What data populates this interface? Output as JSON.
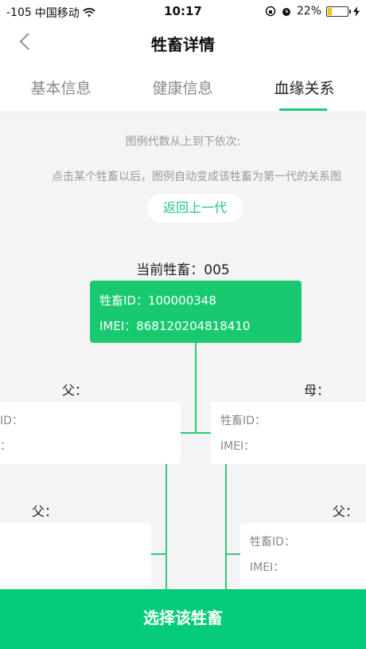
{
  "status_bar": {
    "signal": "-105",
    "carrier": "中国移动",
    "time": "10:17",
    "battery": "22%",
    "battery_level": 0.22
  },
  "nav": {
    "title": "牲畜详情",
    "back_icon": "chevron-left-icon"
  },
  "tabs": [
    {
      "label": "基本信息",
      "active": false
    },
    {
      "label": "健康信息",
      "active": false
    },
    {
      "label": "血缘关系",
      "active": true
    }
  ],
  "hints": {
    "line1": "图例代数从上到下依次:",
    "line2": "点击某个牲畜以后，图例自动变成该牲畜为第一代的关系图"
  },
  "back_button": "返回上一代",
  "current": {
    "label": "当前牲畜：005",
    "id_row": "牲畜ID：100000348",
    "imei_row": "IMEI：868120204818410"
  },
  "gen2": {
    "father_label": "父：",
    "mother_label": "母：",
    "father_card": {
      "id_row": "ID：",
      "imei_row": "："
    },
    "mother_card": {
      "id_row": "牲畜ID：",
      "imei_row": "IMEI："
    }
  },
  "gen3": {
    "left_label": "父：",
    "right_label": "父：",
    "right_card": {
      "id_row": "牲畜ID：",
      "imei_row": "IMEI："
    }
  },
  "bottom_button": "选择该牲畜",
  "colors": {
    "accent": "#18c970",
    "bottom": "#05cc78",
    "line": "#30c97a"
  }
}
